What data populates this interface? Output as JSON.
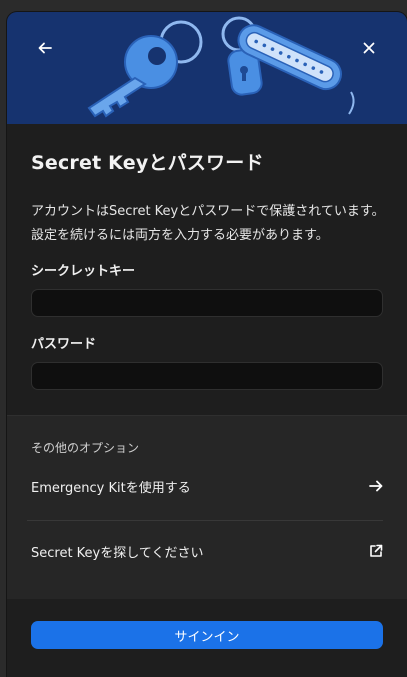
{
  "header": {
    "back_icon": "arrow-left-icon",
    "close_icon": "close-icon",
    "illustration": "keys-on-keyring"
  },
  "main": {
    "title": "Secret Keyとパスワード",
    "description": "アカウントはSecret Keyとパスワードで保護されています。設定を続けるには両方を入力する必要があります。",
    "fields": [
      {
        "label": "シークレットキー",
        "value": "",
        "placeholder": ""
      },
      {
        "label": "パスワード",
        "value": "",
        "placeholder": ""
      }
    ]
  },
  "options": {
    "heading": "その他のオプション",
    "items": [
      {
        "label": "Emergency Kitを使用する",
        "icon": "arrow-right-icon"
      },
      {
        "label": "Secret Keyを探してください",
        "icon": "external-link-icon"
      }
    ]
  },
  "footer": {
    "signin_label": "サインイン"
  },
  "colors": {
    "accent": "#1b72e8",
    "hero_background": "#16336f",
    "panel_background": "#1e1e1e"
  }
}
